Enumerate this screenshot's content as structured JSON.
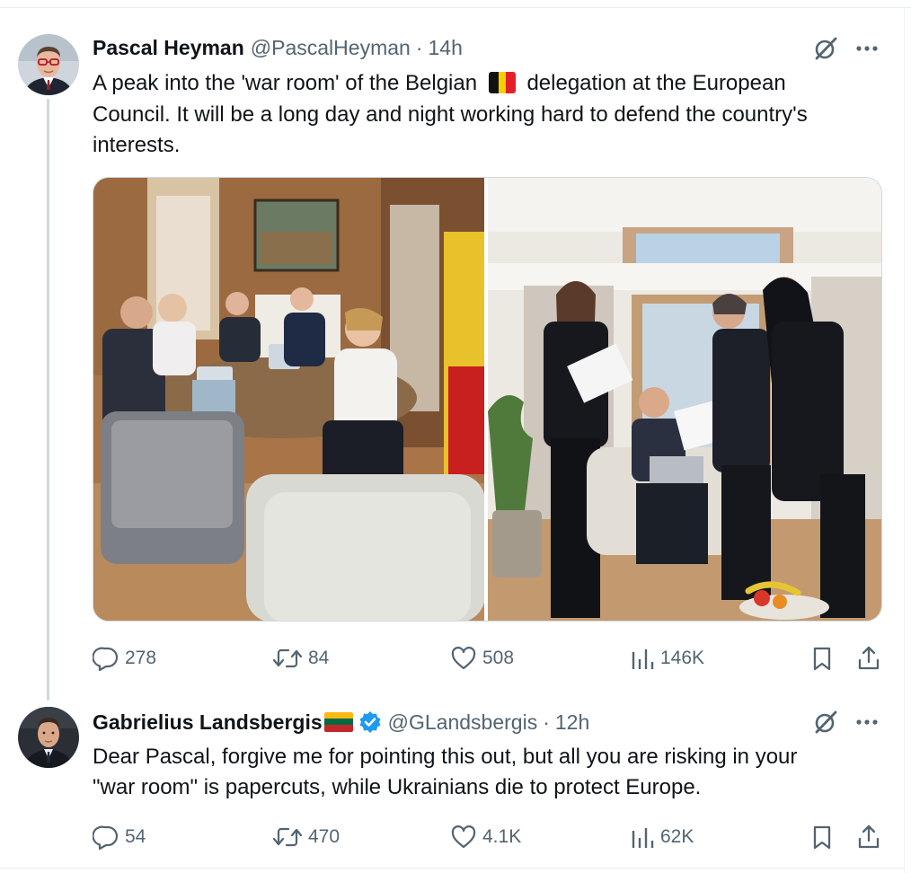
{
  "tweets": [
    {
      "author": {
        "display_name": "Pascal Heyman",
        "handle": "@PascalHeyman",
        "separator": "·",
        "time": "14h"
      },
      "text_lines": [
        "A peak into the 'war room' of the Belgian",
        "delegation at the European",
        "Council. It will be a long day and night working hard to defend the country's",
        "interests."
      ],
      "flag_emoji": "belgium-flag-icon",
      "media": [
        {
          "kind": "photo",
          "subject": "meeting-room"
        },
        {
          "kind": "photo",
          "subject": "people-reviewing-papers"
        }
      ],
      "stats": {
        "replies": "278",
        "reposts": "84",
        "likes": "508",
        "views": "146K"
      }
    },
    {
      "author": {
        "display_name": "Gabrielius Landsbergis",
        "flag_emoji": "lithuania-flag-icon",
        "verified": true,
        "handle": "@GLandsbergis",
        "separator": "·",
        "time": "12h"
      },
      "text_lines": [
        "Dear Pascal, forgive me for pointing this out, but all you are risking in your",
        "\"war room\" is papercuts, while Ukrainians die to protect Europe."
      ],
      "stats": {
        "replies": "54",
        "reposts": "470",
        "likes": "4.1K",
        "views": "62K"
      }
    }
  ],
  "colors": {
    "text_primary": "#0f1419",
    "text_secondary": "#536471",
    "verified_blue": "#1d9bf0",
    "border": "#cfd9de"
  }
}
